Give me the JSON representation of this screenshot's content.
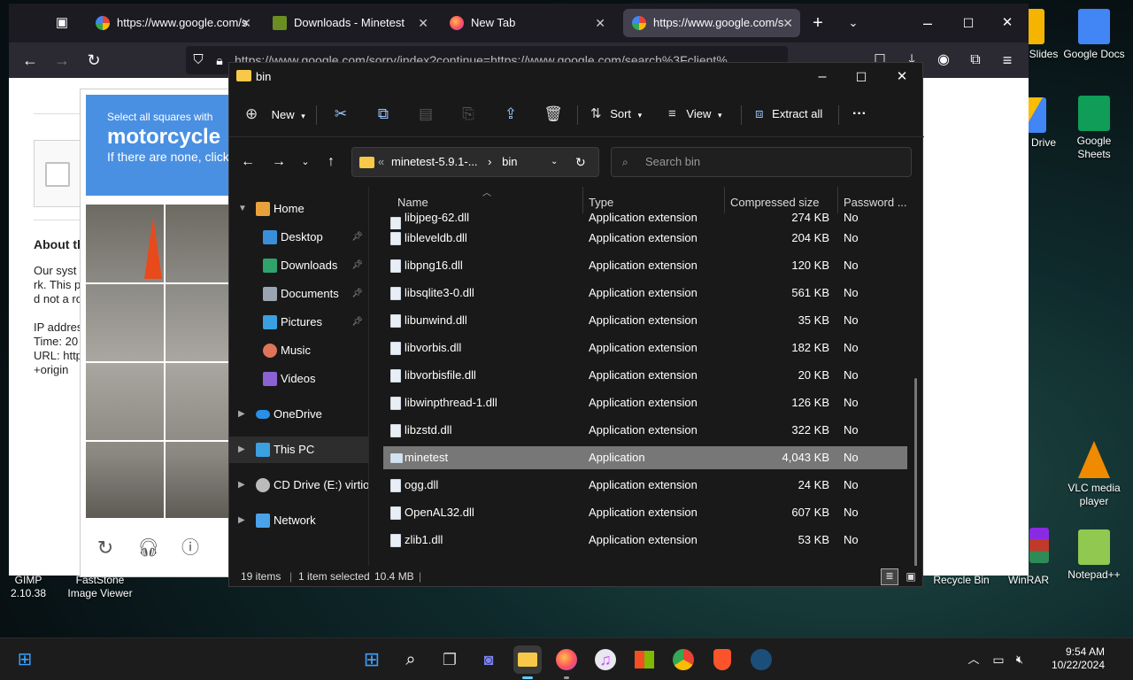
{
  "desktop": {
    "icons_right": [
      {
        "label": "Google Slides",
        "partial": "e Slides"
      },
      {
        "label": "Google Docs"
      },
      {
        "label": "Google Drive",
        "partial": "e Drive"
      },
      {
        "label": "Google Sheets"
      },
      {
        "label": "VLC media player"
      },
      {
        "label": "Notepad++"
      }
    ],
    "icons_bottom": [
      "GIMP 2.10.38",
      "FastStone Image Viewer",
      "Recycle Bin",
      "WinRAR"
    ]
  },
  "browser": {
    "tabs": [
      {
        "title": "https://www.google.com/s",
        "favicon": "google-icon"
      },
      {
        "title": "Downloads - Minetest",
        "favicon": "minetest-icon"
      },
      {
        "title": "New Tab",
        "favicon": "firefox-icon"
      },
      {
        "title": "https://www.google.com/s",
        "favicon": "google-icon",
        "active": true
      }
    ],
    "url": "https://www.google.com/sorry/index?continue=https://www.google.com/search%3Fclient%",
    "page": {
      "captcha_prompt": "Select all squares with",
      "captcha_target": "motorcycle",
      "captcha_hint": "If there are none, click",
      "about_heading": "About th",
      "lines": [
        "Our syst",
        "rk. This p",
        "d not a ro",
        "IP addres",
        "Time: 20",
        "URL: http",
        "+origin"
      ]
    }
  },
  "explorer": {
    "title": "bin",
    "toolbar": {
      "new": "New",
      "sort": "Sort",
      "view": "View",
      "extract_all": "Extract all",
      "more": "···"
    },
    "address": {
      "parent": "minetest-5.9.1-...",
      "current": "bin",
      "sep": "›",
      "overflow": "«"
    },
    "search_placeholder": "Search bin",
    "nav": [
      {
        "label": "Home",
        "icon": "home-icon"
      },
      {
        "label": "Desktop",
        "icon": "desktop-icon",
        "pinned": true
      },
      {
        "label": "Downloads",
        "icon": "download-icon",
        "pinned": true
      },
      {
        "label": "Documents",
        "icon": "documents-icon",
        "pinned": true
      },
      {
        "label": "Pictures",
        "icon": "pictures-icon",
        "pinned": true
      },
      {
        "label": "Music",
        "icon": "music-icon"
      },
      {
        "label": "Videos",
        "icon": "videos-icon"
      },
      {
        "label": "OneDrive",
        "icon": "onedrive-icon"
      },
      {
        "label": "This PC",
        "icon": "pc-icon",
        "selected": true
      },
      {
        "label": "CD Drive (E:) virtio-w",
        "icon": "cd-drive-icon"
      },
      {
        "label": "Network",
        "icon": "network-icon"
      }
    ],
    "columns": [
      "Name",
      "Type",
      "Compressed size",
      "Password ..."
    ],
    "files": [
      {
        "name": "libjpeg-62.dll",
        "type": "Application extension",
        "size": "274 KB",
        "pw": "No"
      },
      {
        "name": "libleveldb.dll",
        "type": "Application extension",
        "size": "204 KB",
        "pw": "No"
      },
      {
        "name": "libpng16.dll",
        "type": "Application extension",
        "size": "120 KB",
        "pw": "No"
      },
      {
        "name": "libsqlite3-0.dll",
        "type": "Application extension",
        "size": "561 KB",
        "pw": "No"
      },
      {
        "name": "libunwind.dll",
        "type": "Application extension",
        "size": "35 KB",
        "pw": "No"
      },
      {
        "name": "libvorbis.dll",
        "type": "Application extension",
        "size": "182 KB",
        "pw": "No"
      },
      {
        "name": "libvorbisfile.dll",
        "type": "Application extension",
        "size": "20 KB",
        "pw": "No"
      },
      {
        "name": "libwinpthread-1.dll",
        "type": "Application extension",
        "size": "126 KB",
        "pw": "No"
      },
      {
        "name": "libzstd.dll",
        "type": "Application extension",
        "size": "322 KB",
        "pw": "No"
      },
      {
        "name": "minetest",
        "type": "Application",
        "size": "4,043 KB",
        "pw": "No",
        "selected": true
      },
      {
        "name": "ogg.dll",
        "type": "Application extension",
        "size": "24 KB",
        "pw": "No"
      },
      {
        "name": "OpenAL32.dll",
        "type": "Application extension",
        "size": "607 KB",
        "pw": "No"
      },
      {
        "name": "zlib1.dll",
        "type": "Application extension",
        "size": "53 KB",
        "pw": "No"
      }
    ],
    "status": {
      "items": "19 items",
      "selected": "1 item selected",
      "size": "10.4 MB"
    }
  },
  "taskbar": {
    "time": "9:54 AM",
    "date": "10/22/2024"
  },
  "colors": {
    "accent": "#60cdff",
    "folder": "#f8c948",
    "selected_row": "#777777"
  }
}
